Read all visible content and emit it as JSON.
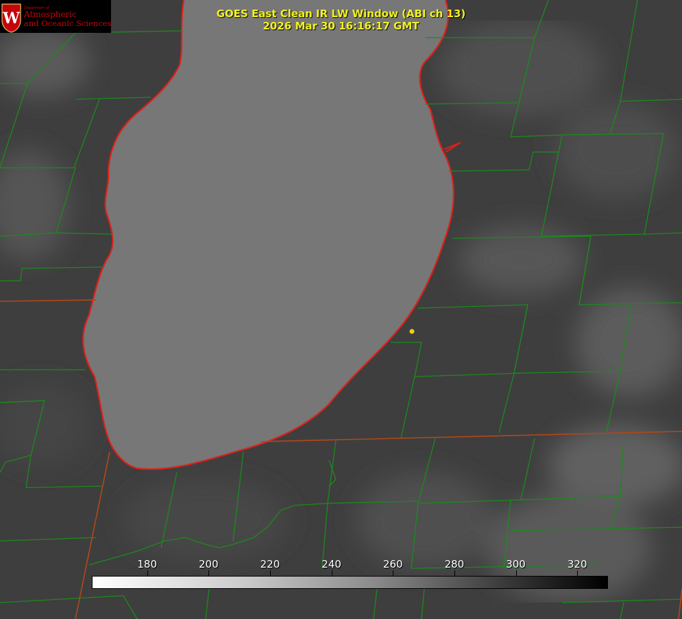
{
  "header": {
    "title_line1": "GOES East Clean IR LW Window (ABI ch 13)",
    "title_line2": "2026 Mar 30 16:16:17 GMT"
  },
  "logo": {
    "department": "Department of",
    "name_line1": "Atmospheric",
    "name_line2": "and Oceanic Sciences",
    "seal_letter": "W"
  },
  "colorbar": {
    "unit_range": [
      162,
      330
    ],
    "ticks": [
      180,
      200,
      220,
      240,
      260,
      280,
      300,
      320
    ],
    "tick_labels": [
      "180",
      "200",
      "220",
      "240",
      "260",
      "280",
      "300",
      "320"
    ]
  },
  "colors": {
    "title": "#f2f21e",
    "lake_outline": "#e0201a",
    "county_lines": "#1c8a1c",
    "state_lines": "#b4471a",
    "station_dot": "#e8d21a",
    "logo_red": "#c5050c"
  }
}
